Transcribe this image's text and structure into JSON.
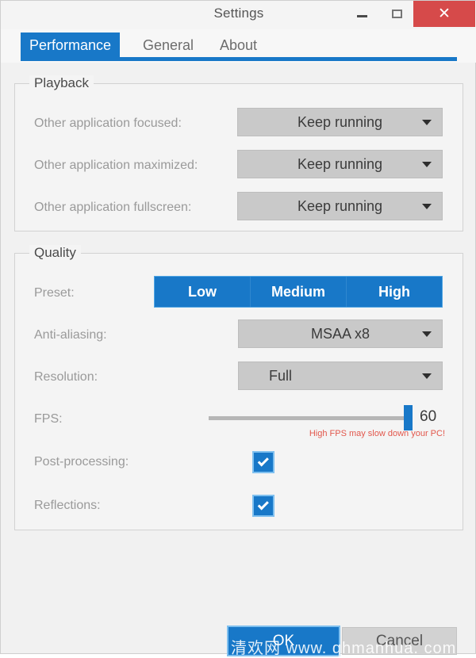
{
  "window": {
    "title": "Settings",
    "controls": {
      "minimize": "minimize-icon",
      "maximize": "maximize-icon",
      "close": "✕"
    },
    "accent_color": "#1878c8",
    "close_color": "#d64a4a"
  },
  "tabs": [
    {
      "label": "Performance",
      "active": true
    },
    {
      "label": "General",
      "active": false
    },
    {
      "label": "About",
      "active": false
    }
  ],
  "playback": {
    "title": "Playback",
    "rows": [
      {
        "label": "Other application focused:",
        "value": "Keep running"
      },
      {
        "label": "Other application maximized:",
        "value": "Keep running"
      },
      {
        "label": "Other application fullscreen:",
        "value": "Keep running"
      }
    ]
  },
  "quality": {
    "title": "Quality",
    "preset": {
      "label": "Preset:",
      "options": [
        "Low",
        "Medium",
        "High"
      ]
    },
    "antialiasing": {
      "label": "Anti-aliasing:",
      "value": "MSAA x8"
    },
    "resolution": {
      "label": "Resolution:",
      "value": "Full"
    },
    "fps": {
      "label": "FPS:",
      "value": "60",
      "warning": "High FPS may slow down your PC!",
      "warning_color": "#e2574c"
    },
    "post_processing": {
      "label": "Post-processing:",
      "checked": true
    },
    "reflections": {
      "label": "Reflections:",
      "checked": true
    }
  },
  "footer": {
    "ok": "OK",
    "cancel": "Cancel"
  },
  "watermark": "清欢网  www. qhmanhua. com"
}
